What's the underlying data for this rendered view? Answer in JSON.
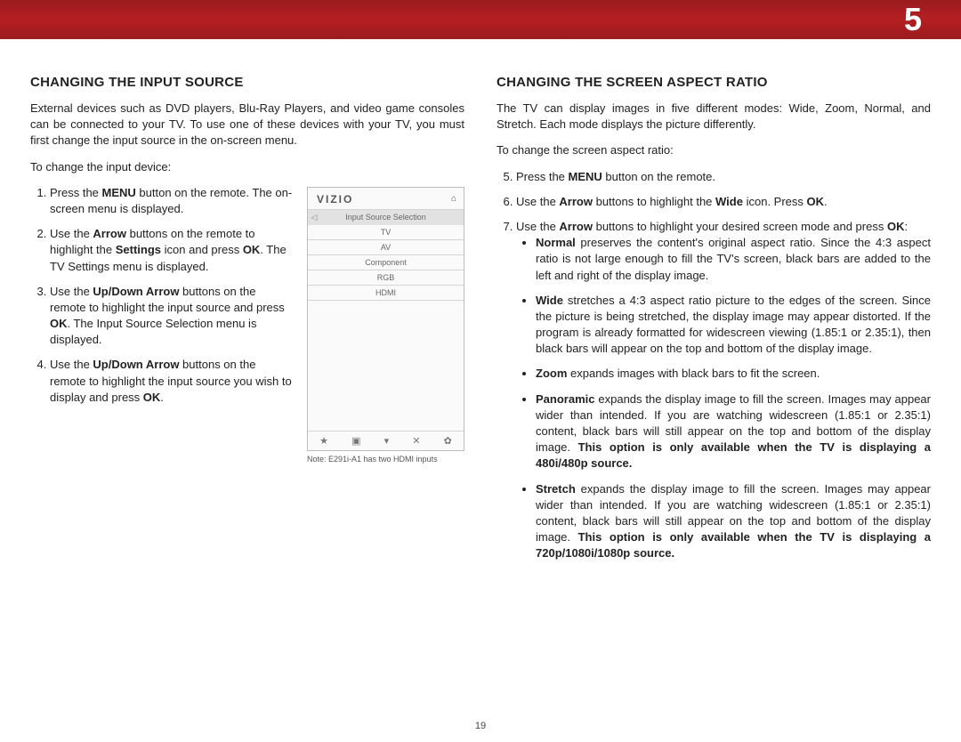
{
  "chapter_no": "5",
  "page_no": "19",
  "left": {
    "heading": "CHANGING THE INPUT SOURCE",
    "intro": "External devices such as DVD players, Blu-Ray Players, and video game consoles can be connected to your TV. To use one of these devices with your TV, you must first change the input source in the on-screen menu.",
    "lead": "To change the input device:",
    "steps": [
      {
        "pre": "Press the ",
        "b1": "MENU",
        "post": " button on the remote. The on-screen menu is displayed."
      },
      {
        "pre": "Use the ",
        "b1": "Arrow",
        "mid1": " buttons on the remote to highlight the ",
        "b2": "Settings",
        "mid2": " icon and press ",
        "b3": "OK",
        "post": ". The TV Settings menu is displayed."
      },
      {
        "pre": "Use the ",
        "b1": "Up/Down Arrow",
        "mid1": " buttons on the remote to highlight the input source and press ",
        "b2": "OK",
        "post": ". The Input Source Selection menu is displayed."
      },
      {
        "pre": "Use the ",
        "b1": "Up/Down Arrow",
        "mid1": " buttons on the remote to highlight the input source you wish to display and press ",
        "b2": "OK",
        "post": "."
      }
    ],
    "tv": {
      "logo": "VIZIO",
      "title": "Input Source Selection",
      "rows": [
        "TV",
        "AV",
        "Component",
        "RGB",
        "HDMI"
      ],
      "note": "Note: E291i-A1 has two HDMI inputs"
    }
  },
  "right": {
    "heading": "CHANGING THE SCREEN ASPECT RATIO",
    "intro": "The TV can display images in five different modes: Wide, Zoom, Normal, and Stretch. Each mode displays the picture differently.",
    "lead": "To change the screen aspect ratio:",
    "steps": {
      "5": {
        "pre": "Press the ",
        "b1": "MENU",
        "post": " button on the remote."
      },
      "6": {
        "pre": "Use the ",
        "b1": "Arrow",
        "mid1": " buttons to highlight the ",
        "b2": "Wide",
        "mid2": " icon. Press ",
        "b3": "OK",
        "post": "."
      },
      "7": {
        "pre": "Use the ",
        "b1": "Arrow",
        "mid1": " buttons to highlight your desired screen mode and press ",
        "b2": "OK",
        "post": ":"
      }
    },
    "modes": {
      "normal": {
        "name": "Normal",
        "text": " preserves the content's original aspect ratio. Since the 4:3 aspect ratio is not large enough to fill the TV's screen, black bars are added to the left and right of the display image."
      },
      "wide": {
        "name": "Wide",
        "text": " stretches a 4:3 aspect ratio picture to the edges of the screen. Since the picture is being stretched, the display image may appear distorted. If the program is already formatted for widescreen viewing (1.85:1 or 2.35:1), then black bars will appear on the top and bottom of the display image."
      },
      "zoom": {
        "name": "Zoom",
        "text": " expands images with black bars to fit the screen."
      },
      "pano": {
        "name": "Panoramic",
        "text": " expands the display image to fill the screen. Images may appear wider than intended. If you are watching widescreen (1.85:1 or 2.35:1) content, black bars will still appear on the top and bottom of the display image. ",
        "tail": "This option is only available when the TV is displaying a 480i/480p source."
      },
      "stretch": {
        "name": "Stretch",
        "text": " expands the display image to fill the screen. Images may appear wider than intended. If you are watching widescreen (1.85:1 or 2.35:1) content, black bars will still appear on the top and bottom of the display image. ",
        "tail": "This option is only available when the TV is displaying a 720p/1080i/1080p source."
      }
    }
  }
}
